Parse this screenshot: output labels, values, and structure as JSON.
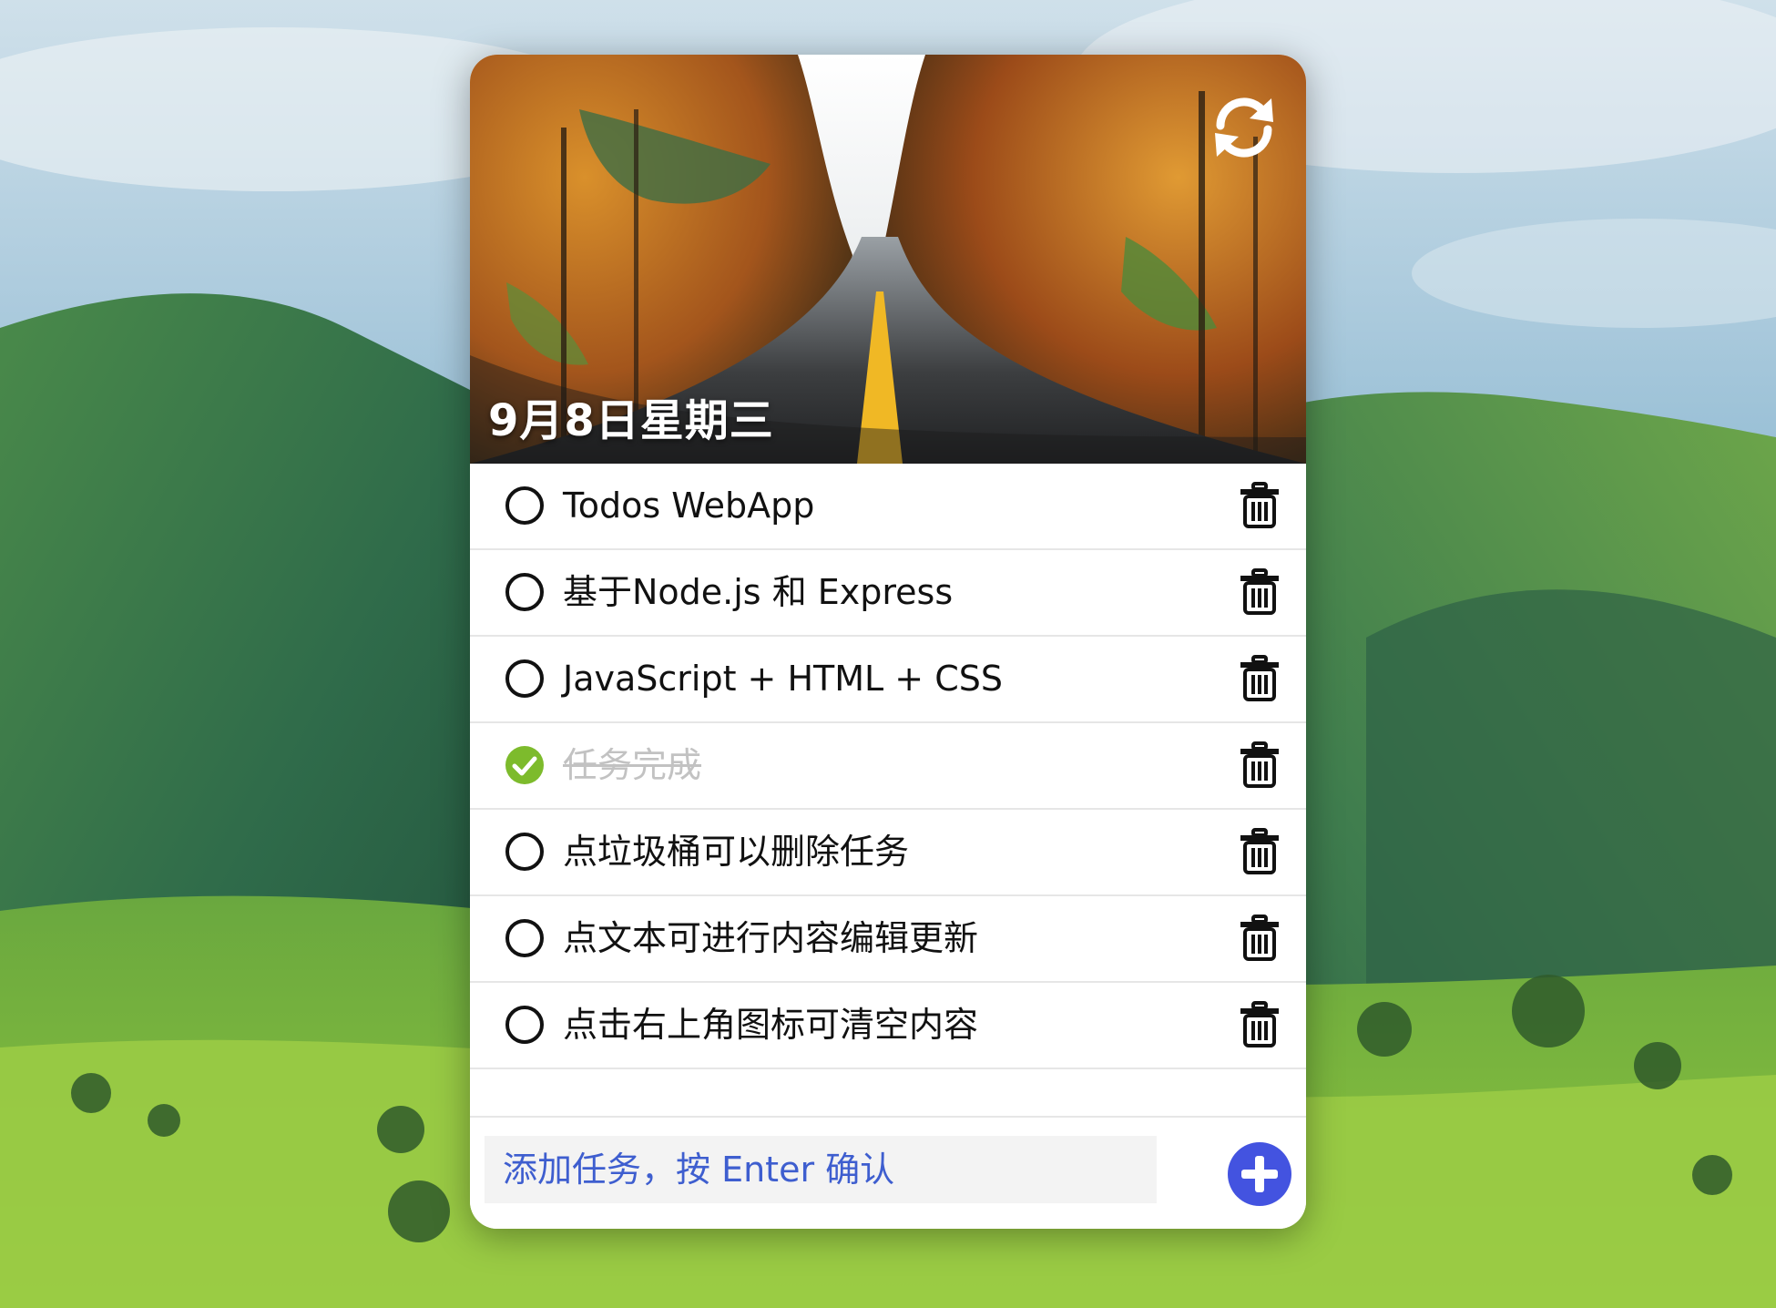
{
  "header": {
    "date": "9月8日星期三",
    "refresh_icon": "refresh-icon"
  },
  "todos": [
    {
      "text": "Todos WebApp",
      "done": false
    },
    {
      "text": "基于Node.js 和 Express",
      "done": false
    },
    {
      "text": "JavaScript + HTML + CSS",
      "done": false
    },
    {
      "text": "任务完成",
      "done": true
    },
    {
      "text": "点垃圾桶可以删除任务",
      "done": false
    },
    {
      "text": "点文本可进行内容编辑更新",
      "done": false
    },
    {
      "text": "点击右上角图标可清空内容",
      "done": false
    }
  ],
  "input": {
    "placeholder": "添加任务，按 Enter 确认",
    "value": ""
  },
  "icons": {
    "check": "circle-check-icon",
    "trash": "trash-icon",
    "add": "plus-circle-icon"
  },
  "colors": {
    "accent": "#4353e0",
    "done_check": "#7dbb2c",
    "done_text": "#c2c2c2",
    "placeholder": "#3e5ecf"
  }
}
